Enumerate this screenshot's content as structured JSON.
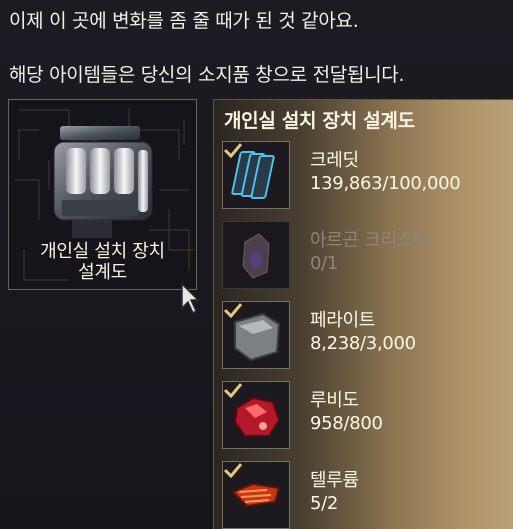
{
  "dialog": {
    "line1": "이제 이 곳에 변화를 좀 줄 때가 된 것 같아요.",
    "line2": "해당 아이템들은 당신의 소지품 창으로 전달됩니다."
  },
  "preview": {
    "label_line1": "개인실 설치 장치",
    "label_line2": "설계도"
  },
  "recipe": {
    "title": "개인실 설치 장치 설계도",
    "materials": [
      {
        "name": "크레딧",
        "quantity": "139,863/100,000",
        "icon": "credit-cards-icon",
        "fulfilled": true
      },
      {
        "name": "아르곤 크리스탈",
        "quantity": "0/1",
        "icon": "argon-crystal-icon",
        "fulfilled": false
      },
      {
        "name": "페라이트",
        "quantity": "8,238/3,000",
        "icon": "ferrite-ore-icon",
        "fulfilled": true
      },
      {
        "name": "루비도",
        "quantity": "958/800",
        "icon": "rubido-ore-icon",
        "fulfilled": true
      },
      {
        "name": "텔루륨",
        "quantity": "5/2",
        "icon": "tellurium-ore-icon",
        "fulfilled": true
      }
    ]
  },
  "colors": {
    "accent_gold": "#d9b66a",
    "panel_border": "#6d6654",
    "text": "#f2ede2"
  }
}
